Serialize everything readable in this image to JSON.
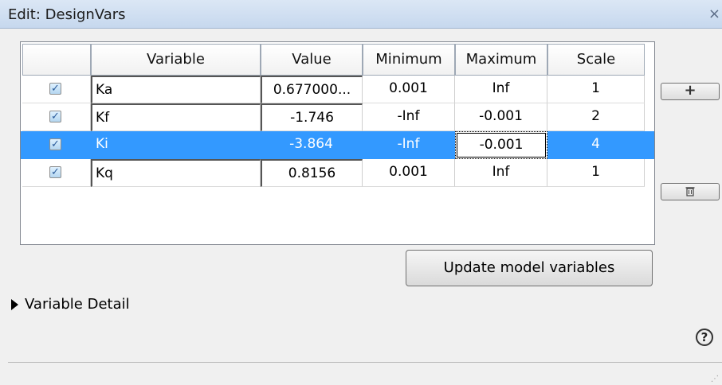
{
  "window": {
    "title": "Edit: DesignVars",
    "close_glyph": "×"
  },
  "table": {
    "headers": [
      "",
      "Variable",
      "Value",
      "Minimum",
      "Maximum",
      "Scale"
    ],
    "rows": [
      {
        "checked": true,
        "variable": "Ka",
        "value": "0.677000...",
        "minimum": "0.001",
        "maximum": "Inf",
        "scale": "1"
      },
      {
        "checked": true,
        "variable": "Kf",
        "value": "-1.746",
        "minimum": "-Inf",
        "maximum": "-0.001",
        "scale": "2"
      },
      {
        "checked": true,
        "variable": "Ki",
        "value": "-3.864",
        "minimum": "-Inf",
        "maximum": "-0.001",
        "scale": "4"
      },
      {
        "checked": true,
        "variable": "Kq",
        "value": "0.8156",
        "minimum": "0.001",
        "maximum": "Inf",
        "scale": "1"
      }
    ],
    "selected_row": 2
  },
  "buttons": {
    "add_icon": "plus-icon",
    "delete_icon": "trash-icon",
    "update_label": "Update model variables"
  },
  "detail": {
    "label": "Variable Detail",
    "expander_icon": "triangle-right-icon"
  },
  "help": {
    "glyph": "?"
  },
  "colors": {
    "selection": "#3399ff",
    "title_bar": "#c6d8ee"
  }
}
